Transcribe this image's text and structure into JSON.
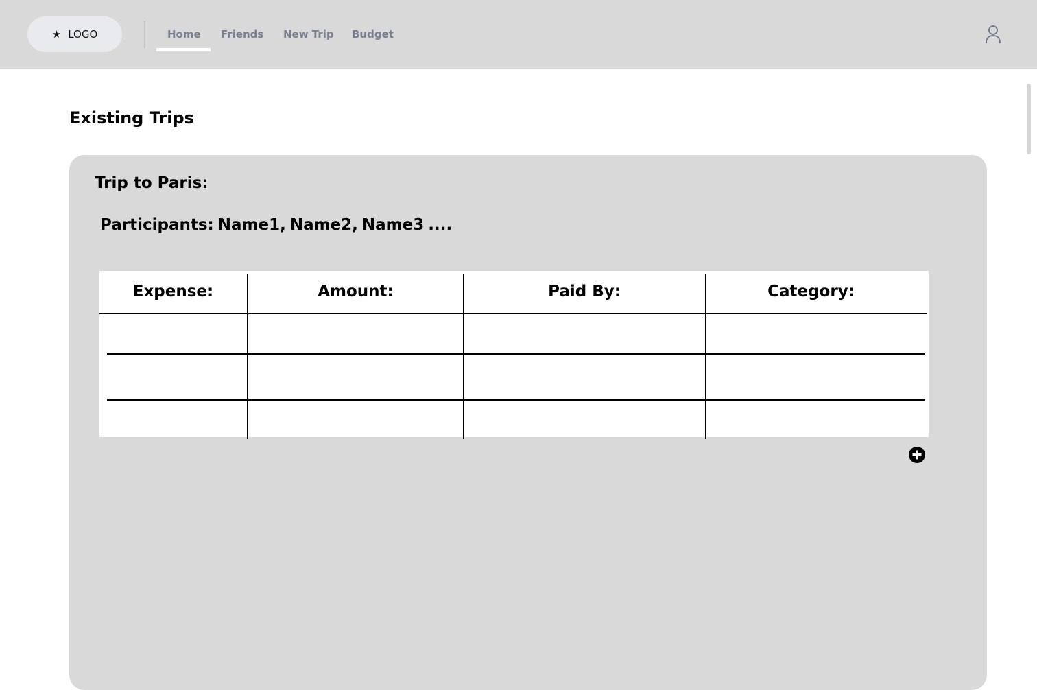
{
  "header": {
    "logo": {
      "icon": "star-icon",
      "label": "LOGO"
    },
    "nav": [
      {
        "label": "Home",
        "active": true
      },
      {
        "label": "Friends",
        "active": false
      },
      {
        "label": "New Trip",
        "active": false
      },
      {
        "label": "Budget",
        "active": false
      }
    ],
    "user_icon": "user-icon"
  },
  "main": {
    "title": "Existing Trips",
    "trip": {
      "title": "Trip to Paris:",
      "participants_label": "Participants:",
      "participants": [
        "Name1,",
        "Name2,",
        "Name3",
        "...."
      ],
      "table": {
        "headers": [
          "Expense:",
          "Amount:",
          "Paid By:",
          "Category:"
        ],
        "rows": [
          [
            "",
            "",
            "",
            ""
          ],
          [
            "",
            "",
            "",
            ""
          ],
          [
            "",
            "",
            "",
            ""
          ]
        ]
      },
      "add_icon": "plus-circle-icon"
    }
  },
  "colors": {
    "header_bg": "#d9d9d9",
    "card_bg": "#d9d9d9",
    "nav_text": "#7a8191",
    "logo_pill": "#e9eaed"
  }
}
